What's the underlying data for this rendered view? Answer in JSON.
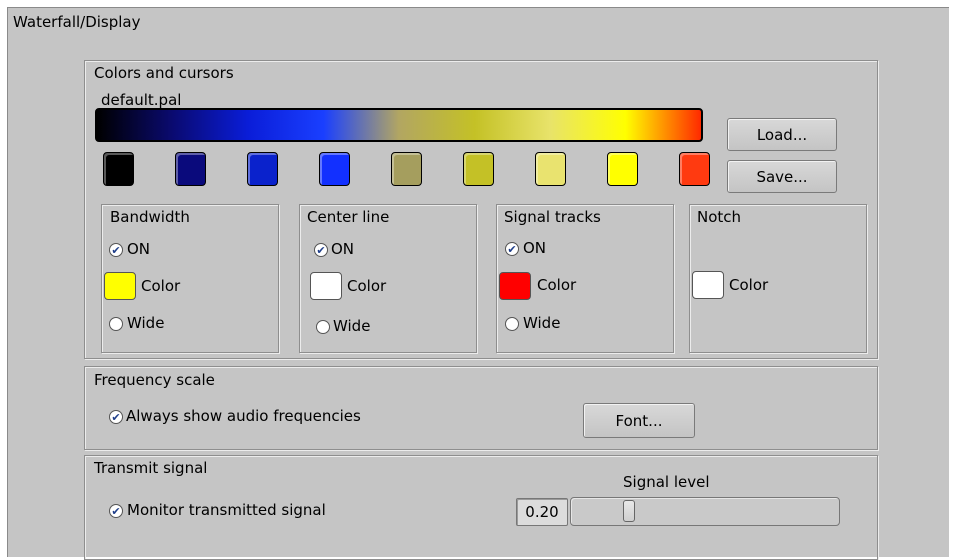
{
  "panel_title": "Waterfall/Display",
  "colors_group": {
    "title": "Colors and cursors",
    "palette_name": "default.pal",
    "gradient_stops": [
      "#000000",
      "#0a0a70",
      "#0a1dd8",
      "#1a3fff",
      "#b2a662",
      "#c4c126",
      "#e8e36a",
      "#ffff00",
      "#ff2a00"
    ],
    "swatches": [
      "#000000",
      "#0a0a7c",
      "#0a22cc",
      "#1230ff",
      "#a59e5e",
      "#c4c126",
      "#e9e36f",
      "#ffff00",
      "#ff3a10"
    ],
    "load_label": "Load...",
    "save_label": "Save..."
  },
  "bandwidth": {
    "title": "Bandwidth",
    "on_label": "ON",
    "on_checked": true,
    "color_label": "Color",
    "color": "#ffff00",
    "wide_label": "Wide",
    "wide_checked": false
  },
  "center_line": {
    "title": "Center line",
    "on_label": "ON",
    "on_checked": true,
    "color_label": "Color",
    "color": "#ffffff",
    "wide_label": "Wide",
    "wide_checked": false
  },
  "signal_tracks": {
    "title": "Signal tracks",
    "on_label": "ON",
    "on_checked": true,
    "color_label": "Color",
    "color": "#ff0000",
    "wide_label": "Wide",
    "wide_checked": false
  },
  "notch": {
    "title": "Notch",
    "color_label": "Color",
    "color": "#ffffff"
  },
  "frequency_scale": {
    "title": "Frequency scale",
    "always_show_label": "Always show audio frequencies",
    "always_show_checked": true,
    "font_label": "Font..."
  },
  "transmit_signal": {
    "title": "Transmit signal",
    "monitor_label": "Monitor transmitted signal",
    "monitor_checked": true,
    "signal_level_label": "Signal level",
    "signal_level_value": "0.20",
    "signal_level_fraction": 0.2
  }
}
